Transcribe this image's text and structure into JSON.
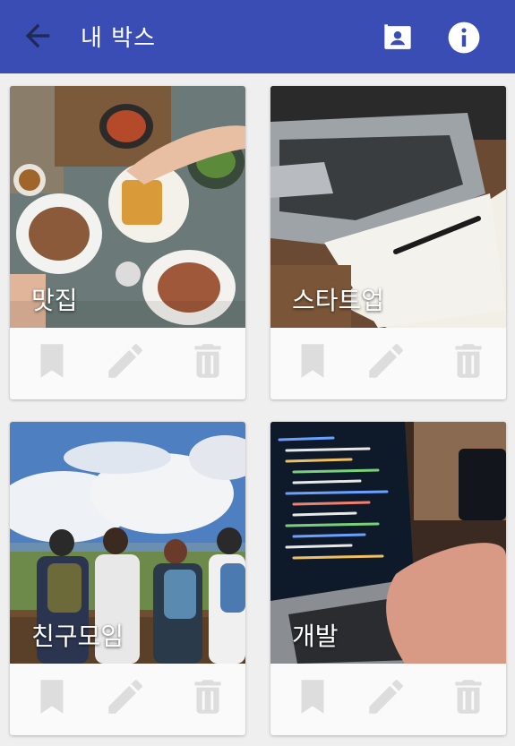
{
  "header": {
    "title": "내 박스",
    "back_icon": "arrow-back-icon",
    "contact_icon": "contact-card-icon",
    "info_icon": "info-icon",
    "bar_color": "#3a4db5"
  },
  "cards": [
    {
      "label": "맛집",
      "photo": "food-table-photo"
    },
    {
      "label": "스타트업",
      "photo": "laptop-notebook-photo"
    },
    {
      "label": "친구모임",
      "photo": "friends-landscape-photo"
    },
    {
      "label": "개발",
      "photo": "coding-laptop-photo"
    }
  ],
  "card_actions": {
    "bookmark_icon": "bookmark-icon",
    "edit_icon": "pencil-icon",
    "delete_icon": "trash-icon",
    "icon_color": "#dddddd"
  }
}
